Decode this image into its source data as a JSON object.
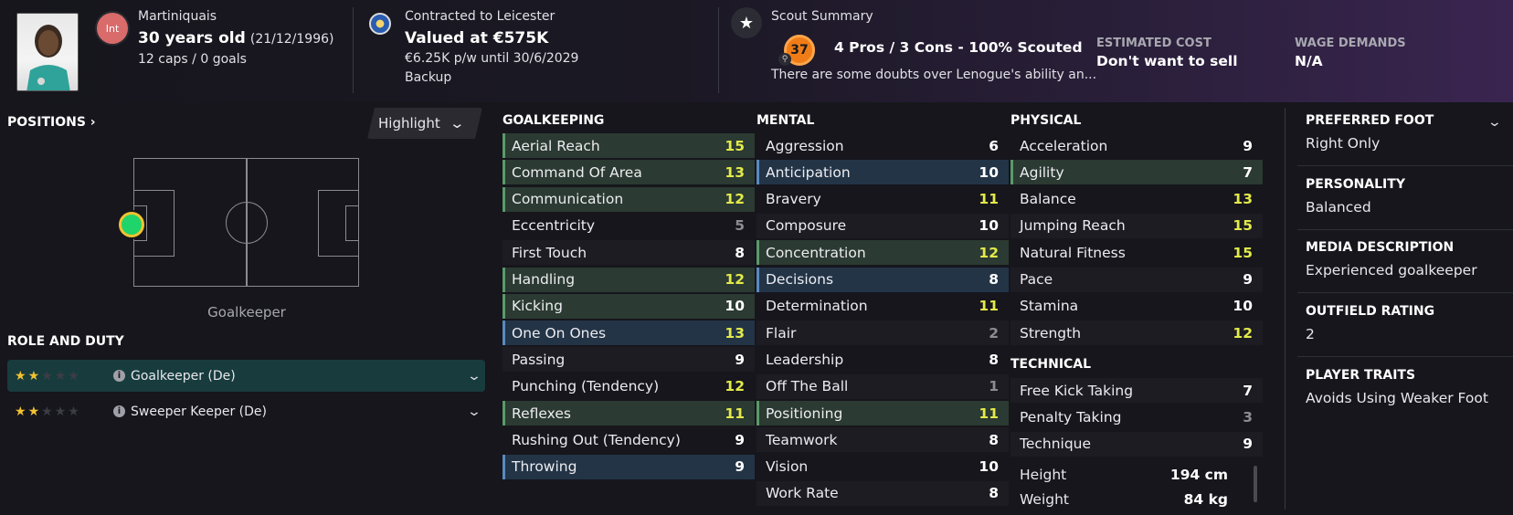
{
  "header": {
    "nationality": "Martiniquais",
    "int_badge": "Int",
    "age": "30 years old",
    "dob": "(21/12/1996)",
    "caps": "12 caps / 0 goals",
    "contract_title": "Contracted to Leicester",
    "value": "Valued at €575K",
    "wage_contract": "€6.25K p/w until 30/6/2029",
    "squad_status": "Backup",
    "scout_title": "Scout Summary",
    "scout_score": "37",
    "scout_line": "4 Pros / 3 Cons - 100% Scouted",
    "scout_desc": "There are some doubts over Lenogue's ability an...",
    "cost_label": "ESTIMATED COST",
    "cost_value": "Don't want to sell",
    "wage_label": "WAGE DEMANDS",
    "wage_value": "N/A"
  },
  "left": {
    "positions_title": "POSITIONS",
    "highlight_label": "Highlight",
    "position_label": "Goalkeeper",
    "role_title": "ROLE AND DUTY",
    "roles": [
      {
        "name": "Goalkeeper (De)",
        "stars": 2
      },
      {
        "name": "Sweeper Keeper (De)",
        "stars": 2
      }
    ]
  },
  "attributes": {
    "goalkeeping": {
      "title": "GOALKEEPING",
      "items": [
        {
          "name": "Aerial Reach",
          "value": "15",
          "hl": "green",
          "color": "yellow"
        },
        {
          "name": "Command Of Area",
          "value": "13",
          "hl": "green",
          "color": "yellow"
        },
        {
          "name": "Communication",
          "value": "12",
          "hl": "green",
          "color": "yellow"
        },
        {
          "name": "Eccentricity",
          "value": "5",
          "hl": "",
          "color": "grey"
        },
        {
          "name": "First Touch",
          "value": "8",
          "hl": "alt",
          "color": "white"
        },
        {
          "name": "Handling",
          "value": "12",
          "hl": "green",
          "color": "yellow"
        },
        {
          "name": "Kicking",
          "value": "10",
          "hl": "green",
          "color": "white"
        },
        {
          "name": "One On Ones",
          "value": "13",
          "hl": "blue",
          "color": "yellow"
        },
        {
          "name": "Passing",
          "value": "9",
          "hl": "alt",
          "color": "white"
        },
        {
          "name": "Punching (Tendency)",
          "value": "12",
          "hl": "",
          "color": "yellow"
        },
        {
          "name": "Reflexes",
          "value": "11",
          "hl": "green",
          "color": "yellow"
        },
        {
          "name": "Rushing Out (Tendency)",
          "value": "9",
          "hl": "",
          "color": "white"
        },
        {
          "name": "Throwing",
          "value": "9",
          "hl": "blue",
          "color": "white"
        }
      ]
    },
    "mental": {
      "title": "MENTAL",
      "items": [
        {
          "name": "Aggression",
          "value": "6",
          "hl": "",
          "color": "white"
        },
        {
          "name": "Anticipation",
          "value": "10",
          "hl": "blue",
          "color": "white"
        },
        {
          "name": "Bravery",
          "value": "11",
          "hl": "",
          "color": "yellow"
        },
        {
          "name": "Composure",
          "value": "10",
          "hl": "alt",
          "color": "white"
        },
        {
          "name": "Concentration",
          "value": "12",
          "hl": "green",
          "color": "yellow"
        },
        {
          "name": "Decisions",
          "value": "8",
          "hl": "blue",
          "color": "white"
        },
        {
          "name": "Determination",
          "value": "11",
          "hl": "",
          "color": "yellow"
        },
        {
          "name": "Flair",
          "value": "2",
          "hl": "alt",
          "color": "grey"
        },
        {
          "name": "Leadership",
          "value": "8",
          "hl": "",
          "color": "white"
        },
        {
          "name": "Off The Ball",
          "value": "1",
          "hl": "alt",
          "color": "grey"
        },
        {
          "name": "Positioning",
          "value": "11",
          "hl": "green",
          "color": "yellow"
        },
        {
          "name": "Teamwork",
          "value": "8",
          "hl": "alt",
          "color": "white"
        },
        {
          "name": "Vision",
          "value": "10",
          "hl": "",
          "color": "white"
        },
        {
          "name": "Work Rate",
          "value": "8",
          "hl": "alt",
          "color": "white"
        }
      ]
    },
    "physical": {
      "title": "PHYSICAL",
      "items": [
        {
          "name": "Acceleration",
          "value": "9",
          "hl": "",
          "color": "white"
        },
        {
          "name": "Agility",
          "value": "7",
          "hl": "green",
          "color": "white"
        },
        {
          "name": "Balance",
          "value": "13",
          "hl": "",
          "color": "yellow"
        },
        {
          "name": "Jumping Reach",
          "value": "15",
          "hl": "alt",
          "color": "yellow"
        },
        {
          "name": "Natural Fitness",
          "value": "15",
          "hl": "",
          "color": "yellow"
        },
        {
          "name": "Pace",
          "value": "9",
          "hl": "alt",
          "color": "white"
        },
        {
          "name": "Stamina",
          "value": "10",
          "hl": "",
          "color": "white"
        },
        {
          "name": "Strength",
          "value": "12",
          "hl": "alt",
          "color": "yellow"
        }
      ]
    },
    "technical": {
      "title": "TECHNICAL",
      "items": [
        {
          "name": "Free Kick Taking",
          "value": "7",
          "hl": "alt",
          "color": "white"
        },
        {
          "name": "Penalty Taking",
          "value": "3",
          "hl": "",
          "color": "grey"
        },
        {
          "name": "Technique",
          "value": "9",
          "hl": "alt",
          "color": "white"
        }
      ]
    },
    "height_label": "Height",
    "height_value": "194 cm",
    "weight_label": "Weight",
    "weight_value": "84 kg"
  },
  "right": {
    "preferred_foot_label": "PREFERRED FOOT",
    "preferred_foot_value": "Right Only",
    "personality_label": "PERSONALITY",
    "personality_value": "Balanced",
    "media_label": "MEDIA DESCRIPTION",
    "media_value": "Experienced goalkeeper",
    "outfield_label": "OUTFIELD RATING",
    "outfield_value": "2",
    "traits_label": "PLAYER TRAITS",
    "traits_value": "Avoids Using Weaker Foot"
  },
  "colors": {
    "yellow": "#e3ea4a",
    "green_highlight": "#2b3a32",
    "blue_highlight": "#233447",
    "selected_role": "#183c3e",
    "scout_orange": "#f07c17"
  }
}
